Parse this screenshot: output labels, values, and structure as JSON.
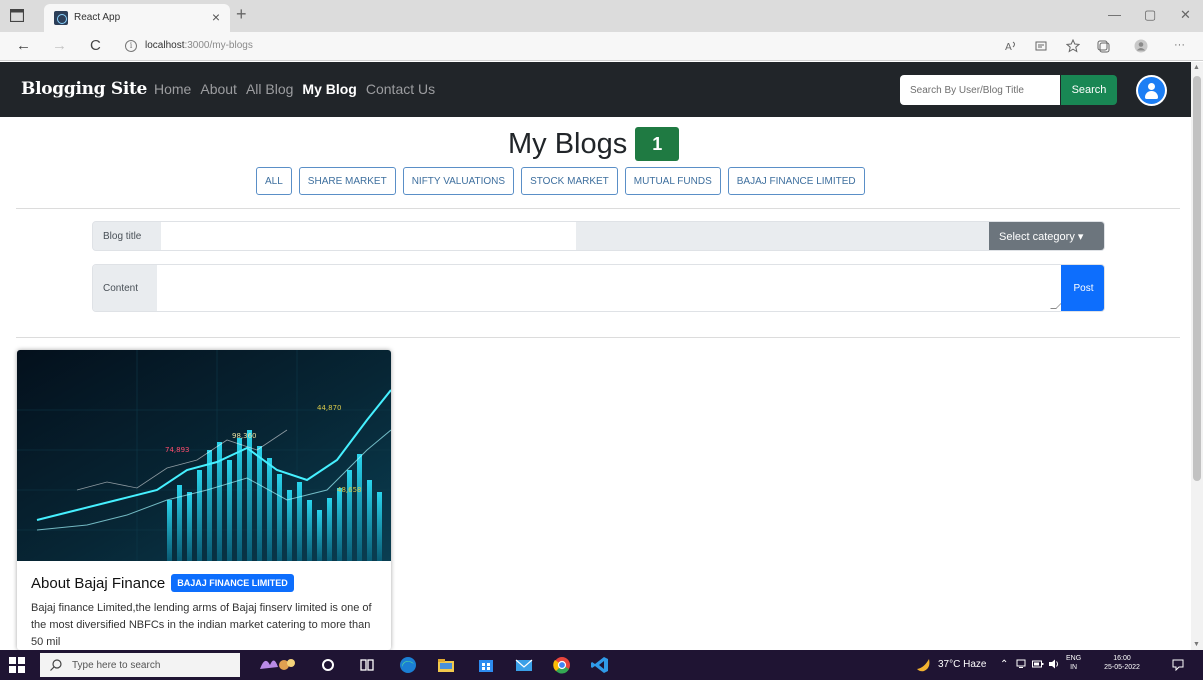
{
  "browser": {
    "tab_title": "React App",
    "tab_close": "×",
    "new_tab": "+",
    "url_host": "localhost",
    "url_path": ":3000/my-blogs",
    "info_icon": "i",
    "back": "←",
    "forward": "→",
    "reload": "C",
    "window_minimize": "—",
    "window_restore": "▢",
    "window_close": "✕",
    "more": "···"
  },
  "navbar": {
    "brand": "Blogging Site",
    "links": [
      {
        "label": "Home",
        "active": false
      },
      {
        "label": "About",
        "active": false
      },
      {
        "label": "All Blog",
        "active": false
      },
      {
        "label": "My Blog",
        "active": true
      },
      {
        "label": "Contact Us",
        "active": false
      }
    ],
    "search_placeholder": "Search By User/Blog Title",
    "search_button": "Search"
  },
  "page": {
    "title": "My Blogs",
    "count": "1",
    "categories": [
      "ALL",
      "SHARE MARKET",
      "NIFTY VALUATIONS",
      "STOCK MARKET",
      "MUTUAL FUNDS",
      "BAJAJ FINANCE LIMITED"
    ]
  },
  "form": {
    "title_label": "Blog title",
    "title_value": "",
    "select_category": "Select category ▾",
    "content_label": "Content",
    "content_value": "",
    "post_button": "Post"
  },
  "blogs": [
    {
      "title": "About Bajaj Finance",
      "category": "BAJAJ FINANCE LIMITED",
      "excerpt": "Bajaj finance Limited,the lending arms of Bajaj finserv limited is one of the most diversified NBFCs in the indian market catering to more than 50 mil",
      "image_labels": [
        "44,870",
        "98,360",
        "74,893",
        "48,658"
      ]
    }
  ],
  "taskbar": {
    "search_placeholder": "Type here to search",
    "weather": "37°C Haze",
    "language_line1": "ENG",
    "language_line2": "IN",
    "time": "16:00",
    "date": "25-05-2022"
  },
  "colors": {
    "navbar_bg": "#212529",
    "search_btn": "#198754",
    "count_badge": "#1f7a42",
    "post_btn": "#0d6efd",
    "category_badge": "#0d6efd",
    "select_btn": "#6c757d",
    "avatar": "#1c7ef4"
  }
}
